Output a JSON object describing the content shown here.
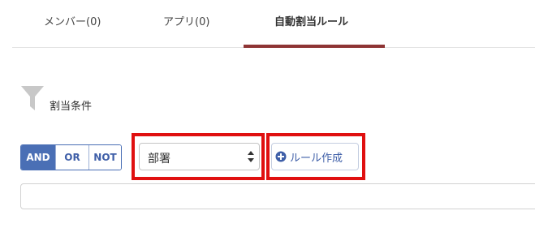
{
  "tabs": [
    {
      "label": "メンバー(0)",
      "active": false
    },
    {
      "label": "アプリ(0)",
      "active": false
    },
    {
      "label": "自動割当ルール",
      "active": true
    }
  ],
  "condition_section": {
    "icon": "filter-icon",
    "label": "割当条件"
  },
  "logic_buttons": [
    {
      "label": "AND",
      "active": true
    },
    {
      "label": "OR",
      "active": false
    },
    {
      "label": "NOT",
      "active": false
    }
  ],
  "field_select": {
    "value": "部署"
  },
  "add_rule_button": {
    "icon": "plus-circle-icon",
    "label": "ルール作成"
  },
  "colors": {
    "accent": "#4a6fb5",
    "active_tab_underline": "#8e3434",
    "highlight": "#e01010"
  }
}
